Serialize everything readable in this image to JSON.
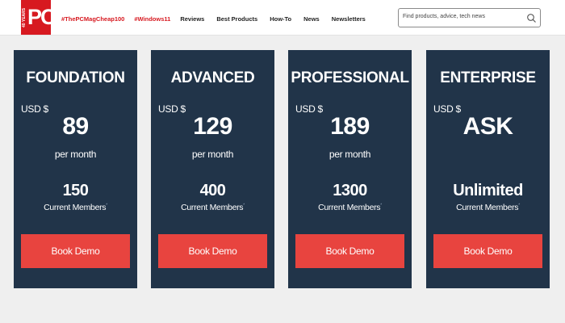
{
  "header": {
    "logo": {
      "text": "PC",
      "years_label": "40 YEARS"
    },
    "nav": [
      {
        "label": "#ThePCMagCheap100",
        "style": "red"
      },
      {
        "label": "#Windows11",
        "style": "red"
      },
      {
        "label": "Reviews",
        "style": "normal"
      },
      {
        "label": "Best Products",
        "style": "normal"
      },
      {
        "label": "How-To",
        "style": "normal"
      },
      {
        "label": "News",
        "style": "normal"
      },
      {
        "label": "Newsletters",
        "style": "normal"
      }
    ],
    "search": {
      "placeholder": "Find products, advice, tech news",
      "icon": "search-icon"
    }
  },
  "plans": [
    {
      "name": "FOUNDATION",
      "currency": "USD $",
      "price": "89",
      "period": "per month",
      "members": "150",
      "members_label": "Current Members",
      "members_mark": "*",
      "cta": "Book Demo"
    },
    {
      "name": "ADVANCED",
      "currency": "USD $",
      "price": "129",
      "period": "per month",
      "members": "400",
      "members_label": "Current Members",
      "members_mark": "*",
      "cta": "Book Demo"
    },
    {
      "name": "PROFESSIONAL",
      "currency": "USD $",
      "price": "189",
      "period": "per month",
      "members": "1300",
      "members_label": "Current Members",
      "members_mark": "*",
      "cta": "Book Demo"
    },
    {
      "name": "ENTERPRISE",
      "currency": "USD $",
      "price": "ASK",
      "period": "",
      "members": "Unlimited",
      "members_label": "Current Members",
      "members_mark": "*",
      "cta": "Book Demo"
    }
  ],
  "colors": {
    "brand_red": "#d71920",
    "card_bg": "#213449",
    "cta_bg": "#e8443f",
    "page_bg": "#efefef"
  }
}
